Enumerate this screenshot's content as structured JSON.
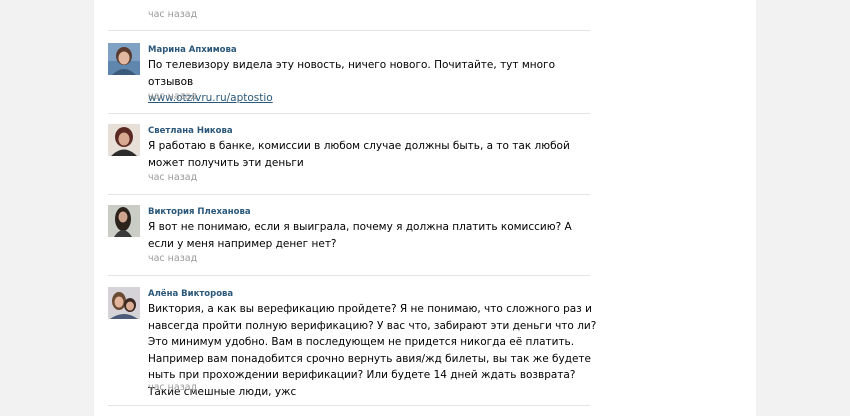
{
  "comments": [
    {
      "time": "час назад"
    },
    {
      "author": "Марина Апхимова",
      "text": "По телевизору видела эту новость, ничего нового. Почитайте, тут много отзывов",
      "link": "www.otzivru.ru/aptostio",
      "time": "час назад"
    },
    {
      "author": "Светлана Никова",
      "text": "Я работаю в банке, комиссии в любом случае должны быть, а то так любой может получить эти деньги",
      "time": "час назад"
    },
    {
      "author": "Виктория Плеханова",
      "text": "Я вот не понимаю, если я выиграла, почему я должна платить комиссию? А если у меня например денег нет?",
      "time": "час назад"
    },
    {
      "author": "Алёна Викторова",
      "text": "Виктория, а как вы верефикацию пройдете? Я не понимаю, что сложного раз и навсегда пройти полную верификацию? У вас что, забирают эти деньги что ли? Это минимум удобно. Вам в последующем не придется никогда её платить. Например вам понадобится срочно вернуть авия/жд билеты, вы так же будете ныть при прохождении верификации? Или будете 14 дней ждать возврата? Такие смешные люди, ужс",
      "time": "час назад"
    }
  ]
}
